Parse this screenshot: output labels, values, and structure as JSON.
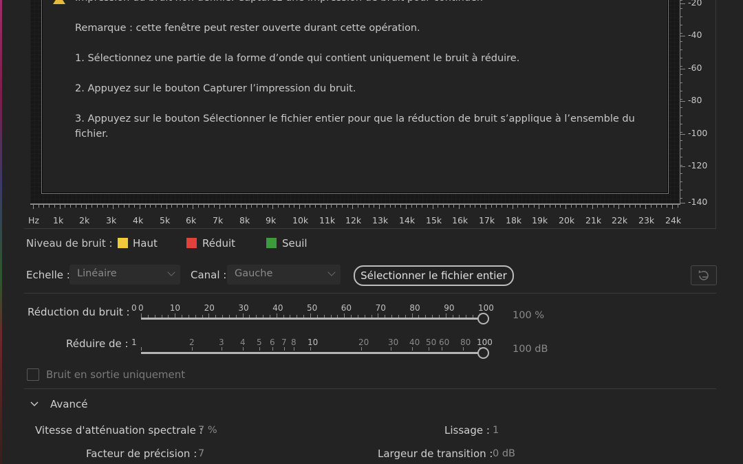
{
  "dialog": {
    "heading_cut": "Impression du bruit non définie. Capturez une impression de bruit pour continuer.",
    "note": "Remarque : cette fenêtre peut rester ouverte durant cette opération.",
    "step1": "1. Sélectionnez une partie de la forme d’onde qui contient uniquement le bruit à réduire.",
    "step2": "2. Appuyez sur le bouton Capturer l’impression du bruit.",
    "step3a": "3. Appuyez sur le bouton Sélectionner le fichier entier pour que la réduction de bruit s’applique à l’ensemble du",
    "step3b": "fichier."
  },
  "db_axis": [
    "-20",
    "-40",
    "-60",
    "-80",
    "-100",
    "-120",
    "-140"
  ],
  "hz_axis": [
    "Hz",
    "1k",
    "2k",
    "3k",
    "4k",
    "5k",
    "6k",
    "7k",
    "8k",
    "9k",
    "10k",
    "11k",
    "12k",
    "13k",
    "14k",
    "15k",
    "16k",
    "17k",
    "18k",
    "19k",
    "20k",
    "21k",
    "22k",
    "23k",
    "24k"
  ],
  "legend": {
    "label": "Niveau de bruit :",
    "items": [
      {
        "label": "Haut",
        "color": "#f2c938"
      },
      {
        "label": "Réduit",
        "color": "#e0413a"
      },
      {
        "label": "Seuil",
        "color": "#3c9b3a"
      }
    ]
  },
  "controls": {
    "scale_label": "Echelle :",
    "scale_value": "Linéaire",
    "channel_label": "Canal :",
    "channel_value": "Gauche",
    "select_file_button": "Sélectionner le fichier entier"
  },
  "noise_reduction": {
    "label": "Réduction du bruit :",
    "ticks": [
      "0",
      "0",
      "10",
      "20",
      "30",
      "40",
      "50",
      "60",
      "70",
      "80",
      "90",
      "100"
    ],
    "value": "100 %",
    "level": 1.0
  },
  "reduce_by": {
    "label": "Réduire de :",
    "ticks": [
      "1",
      "2",
      "3",
      "4",
      "5",
      "6",
      "7",
      "8",
      "10",
      "20",
      "30",
      "40",
      "50",
      "60",
      "80",
      "100"
    ],
    "value": "100 dB",
    "level": 1.0
  },
  "output_noise_only": {
    "label": "Bruit en sortie uniquement",
    "checked": false
  },
  "advanced": {
    "label": "Avancé",
    "spectral_decay_label": "Vitesse d'atténuation spectrale :",
    "spectral_decay_value": "7 %",
    "smoothing_label": "Lissage :",
    "smoothing_value": "1",
    "precision_label": "Facteur de précision :",
    "precision_value": "7",
    "transition_label": "Largeur de transition :",
    "transition_value": "0 dB"
  }
}
